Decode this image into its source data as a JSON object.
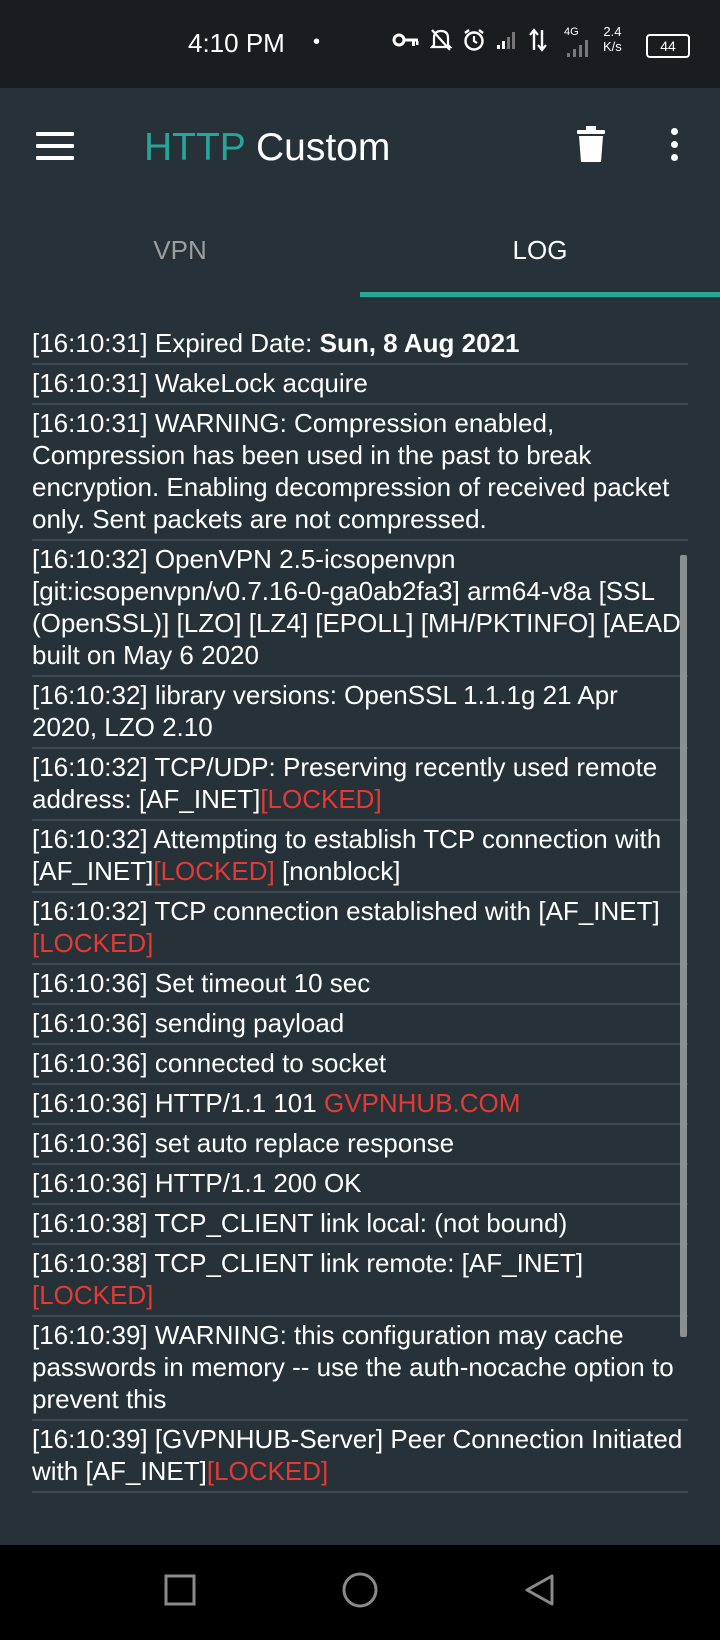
{
  "status_bar": {
    "time": "4:10 PM",
    "dot": "•",
    "network": "4G",
    "speed_value": "2.4",
    "speed_unit": "K/s",
    "battery": "44"
  },
  "app_bar": {
    "title_accent": "HTTP",
    "title_rest": " Custom"
  },
  "tabs": [
    {
      "label": "VPN",
      "selected": false
    },
    {
      "label": "LOG",
      "selected": true
    }
  ],
  "colors": {
    "accent": "#26a69a",
    "background": "#263238",
    "locked": "#e53935"
  },
  "log": [
    {
      "segments": [
        {
          "text": "[16:10:31] Expired Date: "
        },
        {
          "text": "Sun, 8 Aug 2021",
          "style": "bold"
        }
      ]
    },
    {
      "segments": [
        {
          "text": "[16:10:31] WakeLock acquire"
        }
      ]
    },
    {
      "segments": [
        {
          "text": "[16:10:31] WARNING: Compression enabled, Compression has been used in the past to break encryption. Enabling decompression of received packet only. Sent packets are not compressed."
        }
      ]
    },
    {
      "segments": [
        {
          "text": "[16:10:32] OpenVPN 2.5-icsopenvpn [git:icsopenvpn/v0.7.16-0-ga0ab2fa3] arm64-v8a [SSL (OpenSSL)] [LZO] [LZ4] [EPOLL] [MH/PKTINFO] [AEAD] built on May 6 2020"
        }
      ]
    },
    {
      "segments": [
        {
          "text": "[16:10:32] library versions: OpenSSL 1.1.1g 21 Apr 2020, LZO 2.10"
        }
      ]
    },
    {
      "segments": [
        {
          "text": "[16:10:32] TCP/UDP: Preserving recently used remote address: [AF_INET]"
        },
        {
          "text": "[LOCKED]",
          "style": "red"
        }
      ]
    },
    {
      "segments": [
        {
          "text": "[16:10:32] Attempting to establish TCP connection with [AF_INET]"
        },
        {
          "text": "[LOCKED]",
          "style": "red"
        },
        {
          "text": " [nonblock]"
        }
      ]
    },
    {
      "segments": [
        {
          "text": "[16:10:32] TCP connection established with [AF_INET]"
        },
        {
          "text": "[LOCKED]",
          "style": "red"
        }
      ]
    },
    {
      "segments": [
        {
          "text": "[16:10:36] Set timeout 10 sec"
        }
      ]
    },
    {
      "segments": [
        {
          "text": "[16:10:36] sending payload"
        }
      ]
    },
    {
      "segments": [
        {
          "text": "[16:10:36] connected to socket"
        }
      ]
    },
    {
      "segments": [
        {
          "text": "[16:10:36] HTTP/1.1 101 "
        },
        {
          "text": "GVPNHUB.COM",
          "style": "red"
        }
      ]
    },
    {
      "segments": [
        {
          "text": "[16:10:36] set auto replace response"
        }
      ]
    },
    {
      "segments": [
        {
          "text": "[16:10:36] HTTP/1.1 200 OK"
        }
      ]
    },
    {
      "segments": [
        {
          "text": "[16:10:38] TCP_CLIENT link local: (not bound)"
        }
      ]
    },
    {
      "segments": [
        {
          "text": "[16:10:38] TCP_CLIENT link remote: [AF_INET] "
        },
        {
          "text": "[LOCKED]",
          "style": "red"
        }
      ]
    },
    {
      "segments": [
        {
          "text": "[16:10:39] WARNING: this configuration may cache passwords in memory -- use the auth-nocache option to prevent this"
        }
      ]
    },
    {
      "segments": [
        {
          "text": "[16:10:39] [GVPNHUB-Server] Peer Connection Initiated with [AF_INET]"
        },
        {
          "text": "[LOCKED]",
          "style": "red"
        }
      ]
    }
  ],
  "nav_bar": {
    "icons": [
      "recent-apps-icon",
      "home-icon",
      "back-icon"
    ]
  }
}
